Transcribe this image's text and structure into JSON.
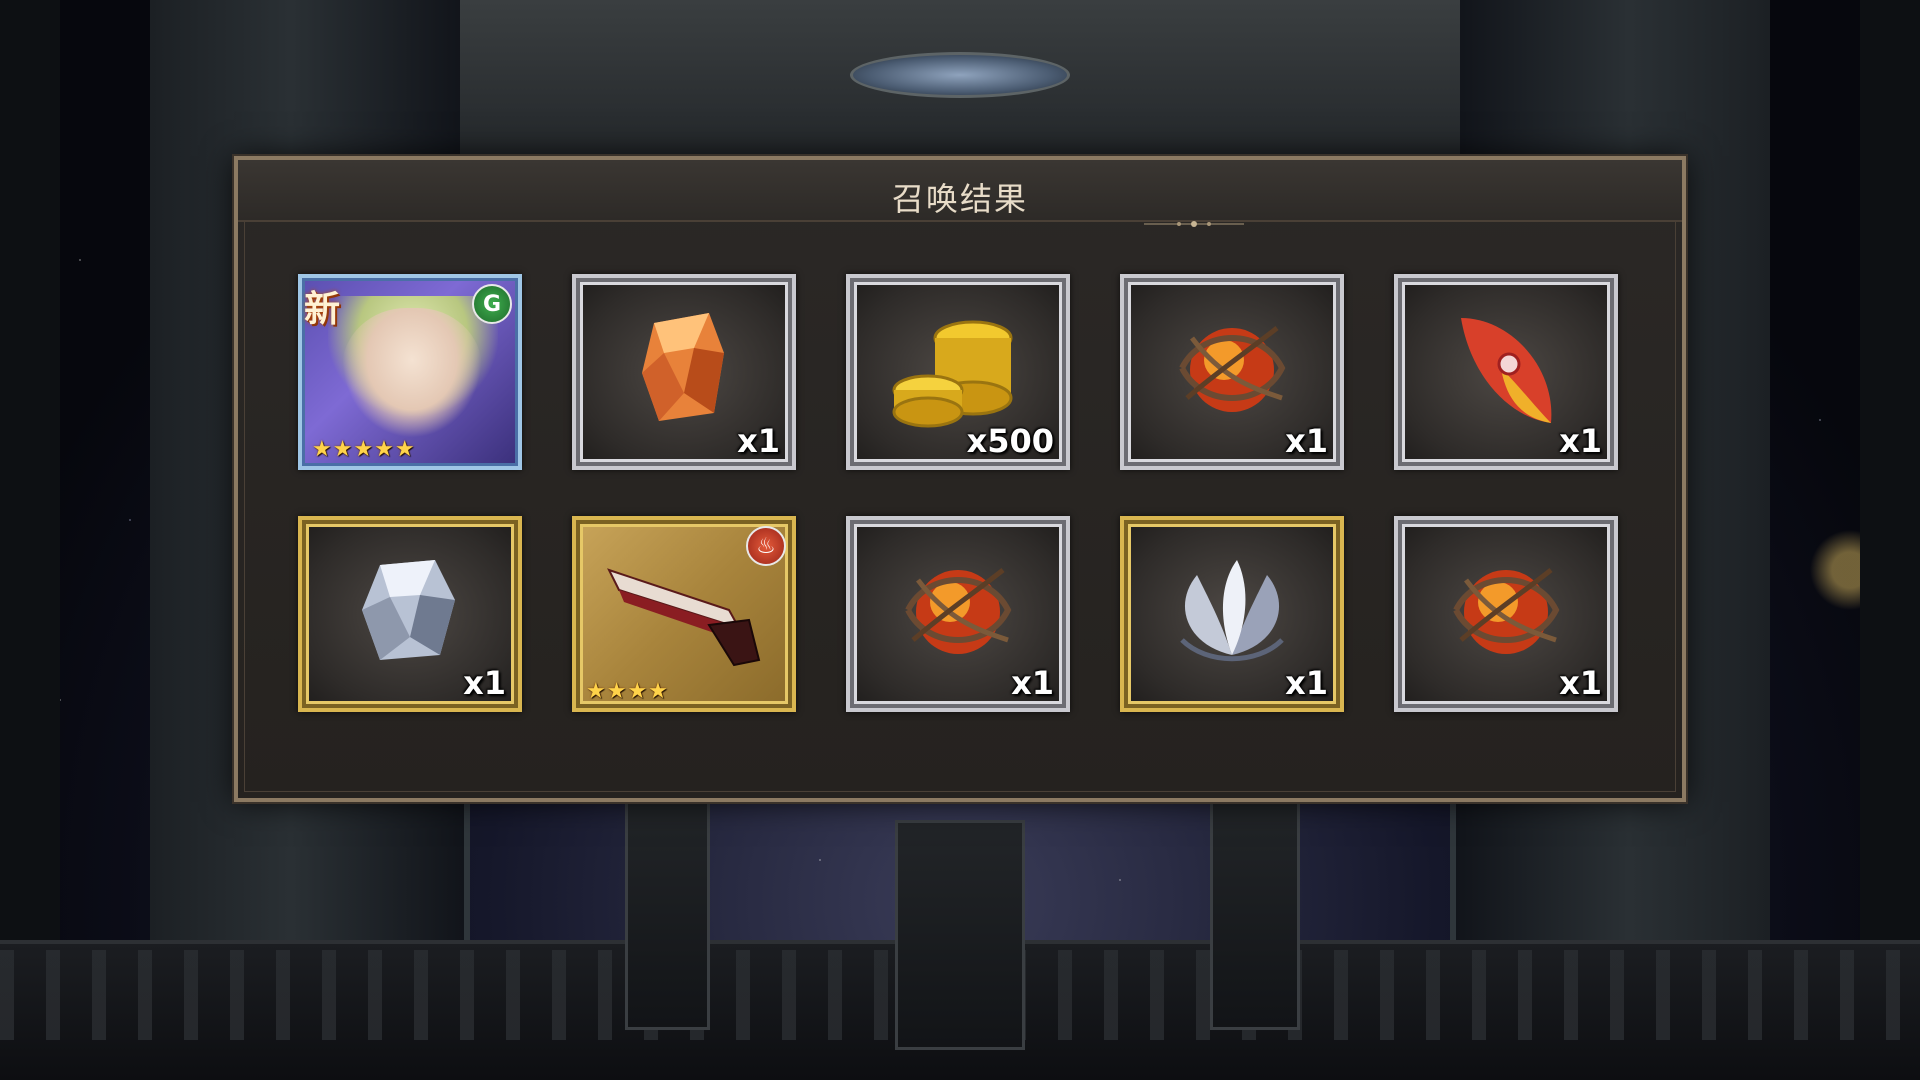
{
  "dialog": {
    "title": "召唤结果"
  },
  "results": [
    {
      "kind": "character",
      "new_label": "新",
      "element": "wind",
      "element_glyph": "G",
      "stars": "★★★★★",
      "frame": "hero"
    },
    {
      "kind": "orange-crystal",
      "quantity": "x1",
      "frame": "silver"
    },
    {
      "kind": "gold-coins",
      "quantity": "x500",
      "frame": "silver"
    },
    {
      "kind": "thorned-fire-orb",
      "quantity": "x1",
      "frame": "silver"
    },
    {
      "kind": "red-feather",
      "quantity": "x1",
      "frame": "silver"
    },
    {
      "kind": "silver-crystal",
      "quantity": "x1",
      "frame": "gold"
    },
    {
      "kind": "pistol-weapon",
      "element": "fire",
      "element_glyph": "♨",
      "stars": "★★★★",
      "frame": "gold"
    },
    {
      "kind": "thorned-fire-orb",
      "quantity": "x1",
      "frame": "silver"
    },
    {
      "kind": "silver-lotus",
      "quantity": "x1",
      "frame": "gold"
    },
    {
      "kind": "thorned-fire-orb",
      "quantity": "x1",
      "frame": "silver"
    }
  ],
  "colors": {
    "frame_silver": "#c9c9cf",
    "frame_gold": "#d9b650",
    "dialog_border": "#8c7a62",
    "title_text": "#e8dcc8"
  }
}
